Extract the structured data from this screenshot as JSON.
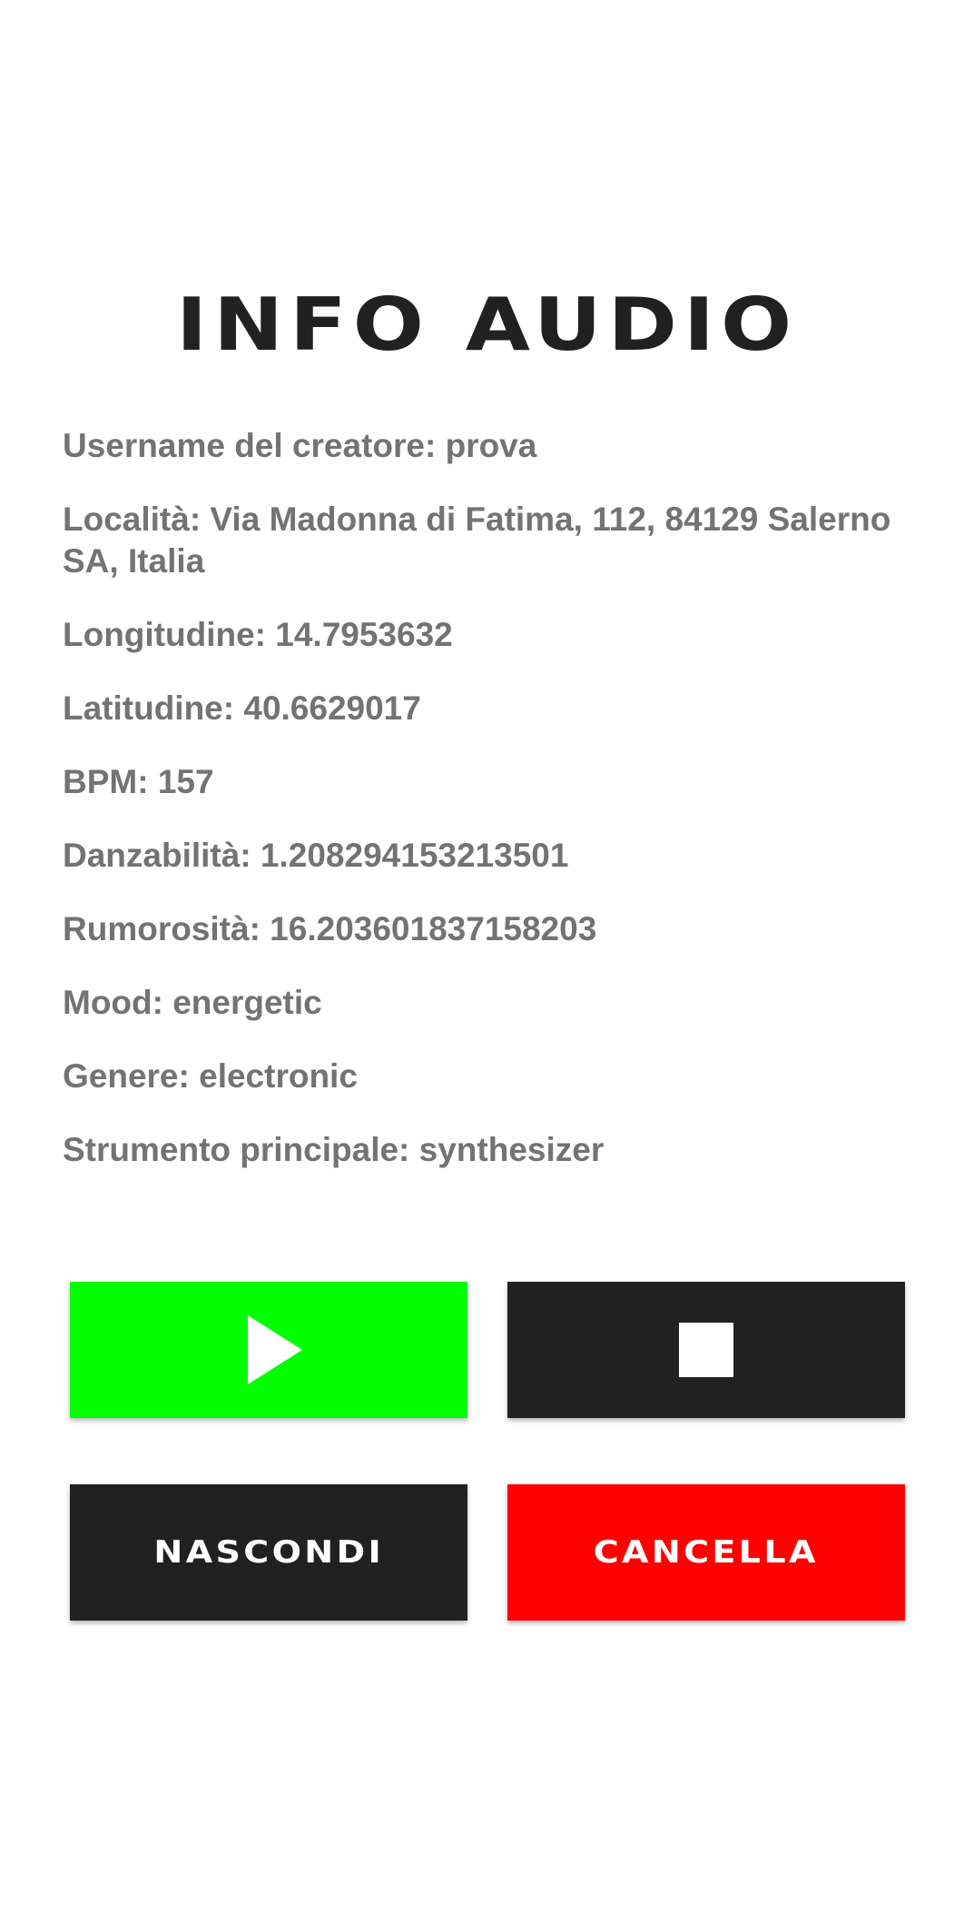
{
  "header": {
    "title": "INFO AUDIO"
  },
  "info": {
    "lines": [
      "Username del creatore: prova",
      "Località: Via Madonna di Fatima, 112, 84129 Salerno SA, Italia",
      "Longitudine: 14.7953632",
      "Latitudine: 40.6629017",
      "BPM: 157",
      "Danzabilità: 1.208294153213501",
      "Rumorosità: 16.203601837158203",
      "Mood: energetic",
      "Genere: electronic",
      "Strumento principale: synthesizer"
    ]
  },
  "controls": {
    "play_icon": "play-icon",
    "stop_icon": "stop-icon",
    "hide_label": "NASCONDI",
    "delete_label": "CANCELLA"
  },
  "colors": {
    "play_button": "#00ff00",
    "stop_button": "#212121",
    "hide_button": "#212121",
    "delete_button": "#ff0000",
    "info_text": "#737373",
    "title_text": "#212121"
  }
}
